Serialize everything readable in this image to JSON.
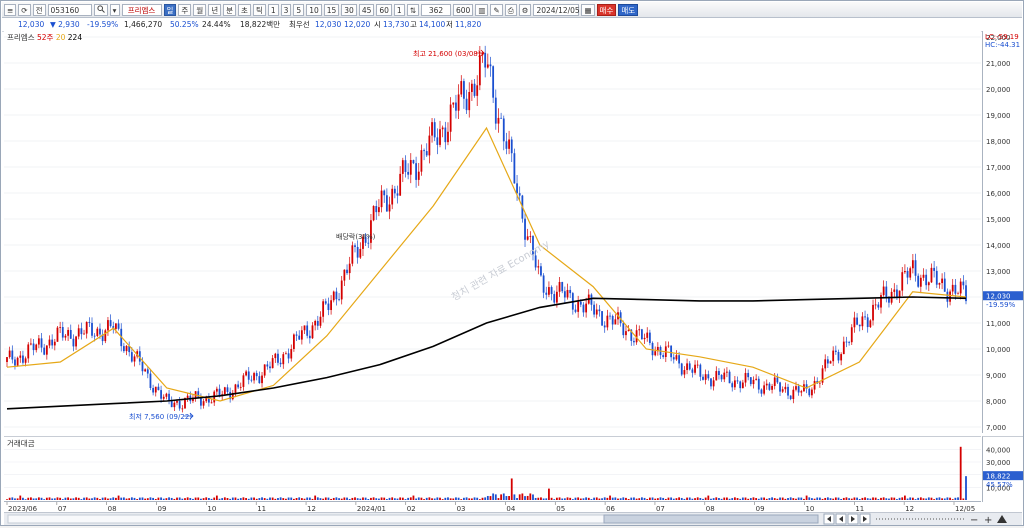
{
  "toolbar": {
    "buttons": [
      "≡",
      "⟳"
    ],
    "market": "전",
    "code": "053160",
    "icons": [
      "search-icon",
      "dropdown-icon"
    ],
    "stock_name": "프리엠스",
    "period_buttons": [
      "일",
      "주",
      "월",
      "년",
      "분",
      "초",
      "틱"
    ],
    "interval_buttons": [
      "1",
      "3",
      "5",
      "10",
      "15",
      "30",
      "45",
      "60"
    ],
    "count_label": "1",
    "count_value": "362",
    "count_total": "600",
    "date_value": "2024/12/05",
    "buy_label": "매수",
    "sell_label": "매도"
  },
  "info": {
    "price": "12,030",
    "change": "▼  2,930",
    "change_pct": "-19.59%",
    "volume": "1,466,270",
    "turnover_pct": "50.25%",
    "rate": "24.44%",
    "amount": "18,822백만",
    "best_bid_label": "최우선",
    "best_bid": "12,030",
    "best_ask": "12,020",
    "open_label": "시",
    "open": "13,730",
    "high_label": "고",
    "high": "14,100",
    "low_label": "저",
    "low": "11,820"
  },
  "legend": {
    "name": "프리엠스",
    "ma1": "52주",
    "ma2": "20",
    "ma3": "224"
  },
  "annotations": {
    "high": "최고 21,600 (03/08)",
    "low": "최저 7,560 (09/22)",
    "event": "배당락(3Ⅱ%)",
    "watermark": "청치 관련 자료 Economy",
    "lc": "LC:-59.19",
    "hc": "HC:-44.31",
    "price_tag": "12,030",
    "price_tag_pct": "-19.59%"
  },
  "y_ticks": [
    "22,000",
    "21,000",
    "20,000",
    "19,000",
    "18,000",
    "17,000",
    "16,000",
    "15,000",
    "14,000",
    "13,000",
    "12,000",
    "11,000",
    "10,000",
    "9,000",
    "8,000",
    "7,000"
  ],
  "volume": {
    "label": "거래대금",
    "ticks": [
      "40,000",
      "30,000",
      "20,000",
      "10,000"
    ],
    "value_tag": "18,822",
    "pct_tag": "45.57%"
  },
  "x_ticks": [
    "2023/06",
    "07",
    "08",
    "09",
    "10",
    "11",
    "12",
    "2024/01",
    "02",
    "03",
    "04",
    "05",
    "06",
    "07",
    "08",
    "09",
    "10",
    "11",
    "12",
    "12/05"
  ],
  "scroll_icons": [
    "first-icon",
    "prev-icon",
    "next-icon",
    "last-icon",
    "zoom-out-icon",
    "zoom-in-icon"
  ],
  "colors": {
    "up": "#d40000",
    "down": "#1a4fd0",
    "ma20": "#e6a817",
    "ma224": "#000000"
  },
  "chart_data": {
    "type": "candlestick",
    "ylim": [
      7000,
      22000
    ],
    "series": [
      {
        "name": "20",
        "x": [
          "2023/06",
          "07",
          "08",
          "09",
          "10",
          "11",
          "12",
          "2024/01",
          "02",
          "03",
          "04",
          "05",
          "06",
          "07",
          "08",
          "09",
          "10",
          "11",
          "12"
        ],
        "values": [
          9300,
          9500,
          10800,
          8500,
          8000,
          8600,
          10500,
          13000,
          15500,
          18500,
          14000,
          12400,
          10000,
          9700,
          9300,
          8500,
          9500,
          12200,
          12000
        ]
      },
      {
        "name": "224",
        "x": [
          "2023/06",
          "07",
          "08",
          "09",
          "10",
          "11",
          "12",
          "2024/01",
          "02",
          "03",
          "04",
          "05",
          "06",
          "07",
          "08",
          "09",
          "10",
          "11",
          "12"
        ],
        "values": [
          7700,
          7800,
          7900,
          8000,
          8200,
          8500,
          8900,
          9400,
          10100,
          11000,
          11600,
          11950,
          11900,
          11850,
          11850,
          11900,
          11950,
          12000,
          11950
        ]
      },
      {
        "name": "price",
        "x": [
          "2023/06",
          "07",
          "08",
          "09",
          "10",
          "11",
          "12",
          "2024/01",
          "02",
          "03",
          "04",
          "05",
          "06",
          "07",
          "08",
          "09",
          "10",
          "11",
          "12"
        ],
        "values": [
          9500,
          10500,
          10800,
          7900,
          8200,
          9400,
          11500,
          15500,
          18000,
          21000,
          12500,
          11500,
          10300,
          9000,
          8700,
          8300,
          11000,
          13000,
          12030
        ]
      }
    ],
    "highs": {
      "max": {
        "value": 21600,
        "date": "03/08"
      },
      "min": {
        "value": 7560,
        "date": "09/22"
      }
    }
  }
}
